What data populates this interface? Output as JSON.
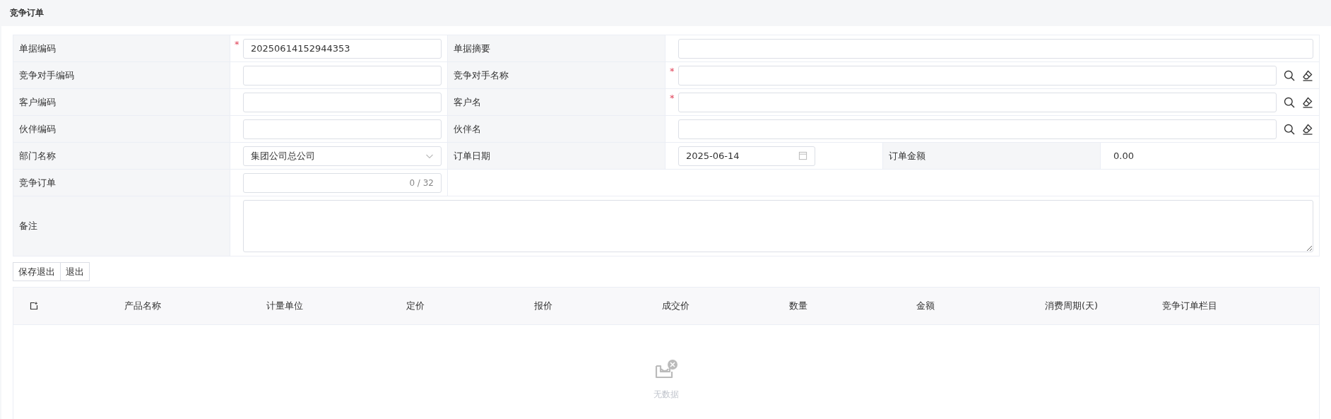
{
  "page_title": "竞争订单",
  "form": {
    "rows": [
      {
        "cells": [
          {
            "kind": "label",
            "text": "单据编码"
          },
          {
            "kind": "input",
            "value": "20250614152944353",
            "mark": "*"
          },
          {
            "kind": "label",
            "text": "单据摘要"
          },
          {
            "kind": "input"
          }
        ]
      },
      {
        "cells": [
          {
            "kind": "label",
            "text": "竞争对手编码"
          },
          {
            "kind": "input"
          },
          {
            "kind": "label",
            "text": "竞争对手名称"
          },
          {
            "kind": "lookup",
            "mark": "*"
          }
        ]
      },
      {
        "cells": [
          {
            "kind": "label",
            "text": "客户编码"
          },
          {
            "kind": "input"
          },
          {
            "kind": "label",
            "text": "客户名"
          },
          {
            "kind": "lookup",
            "mark": "*"
          }
        ]
      },
      {
        "cells": [
          {
            "kind": "label",
            "text": "伙伴编码"
          },
          {
            "kind": "input"
          },
          {
            "kind": "label",
            "text": "伙伴名"
          },
          {
            "kind": "lookup"
          }
        ]
      },
      {
        "cells": [
          {
            "kind": "label",
            "text": "部门名称"
          },
          {
            "kind": "select",
            "value": "集团公司总公司"
          },
          {
            "kind": "label",
            "text": "订单日期"
          },
          {
            "kind": "date",
            "value": "2025-06-14"
          },
          {
            "kind": "label",
            "text": "订单金额"
          },
          {
            "kind": "text",
            "value": "0.00"
          }
        ]
      },
      {
        "cells": [
          {
            "kind": "label",
            "text": "竞争订单"
          },
          {
            "kind": "counter",
            "counter": "0 / 32"
          }
        ]
      },
      {
        "cells": [
          {
            "kind": "label",
            "text": "备注"
          },
          {
            "kind": "textarea"
          }
        ]
      }
    ]
  },
  "buttons": [
    "保存退出",
    "退出"
  ],
  "table": {
    "columns": [
      "产品名称",
      "计量单位",
      "定价",
      "报价",
      "成交价",
      "数量",
      "金额",
      "消费周期(天)",
      "竞争订单栏目"
    ],
    "empty_text": "无数据"
  }
}
